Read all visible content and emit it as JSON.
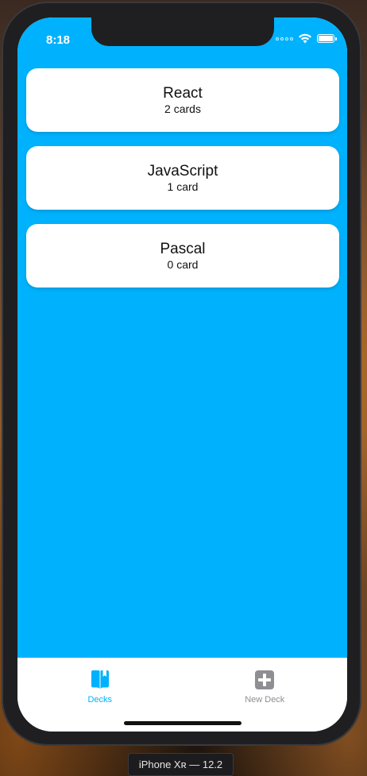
{
  "status_bar": {
    "time": "8:18"
  },
  "decks": [
    {
      "title": "React",
      "count": "2 cards"
    },
    {
      "title": "JavaScript",
      "count": "1 card"
    },
    {
      "title": "Pascal",
      "count": "0 card"
    }
  ],
  "tab_bar": {
    "tabs": [
      {
        "label": "Decks",
        "icon": "book-icon",
        "active": true
      },
      {
        "label": "New Deck",
        "icon": "plus-square-icon",
        "active": false
      }
    ]
  },
  "simulator": {
    "device_label": "iPhone Xʀ — 12.2"
  },
  "colors": {
    "accent": "#00b2fd",
    "inactive_tab": "#8e8e93",
    "card_background": "#ffffff"
  }
}
